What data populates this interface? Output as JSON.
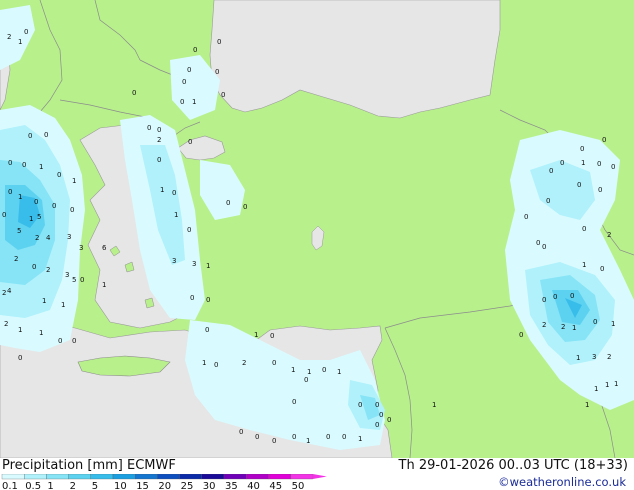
{
  "title": "Precipitation [mm]  ECMWF",
  "date": "Th 29-01-2026 00..03 UTC (18+33)",
  "credit": "©weatheronline.co.uk",
  "colors": {
    "land": "#b8f08c",
    "sea": "#e6e6e6",
    "border": "#8c8c8c",
    "label": "#111111"
  },
  "legend": {
    "ticks": [
      "0.1",
      "0.5",
      "1",
      "2",
      "5",
      "10",
      "15",
      "20",
      "25",
      "30",
      "35",
      "40",
      "45",
      "50"
    ],
    "colors": [
      "#d9fbff",
      "#b0f1fb",
      "#86e4f6",
      "#5dd2f0",
      "#38bdea",
      "#1c9fe0",
      "#1476cf",
      "#0e4fbf",
      "#0a2aa8",
      "#1a0a98",
      "#7000b8",
      "#b000c8",
      "#e000d8",
      "#f233e6"
    ]
  },
  "values": [
    "2",
    "1",
    "0",
    "0",
    "0",
    "0",
    "0",
    "0",
    "0",
    "1",
    "0",
    "0",
    "0",
    "0",
    "0",
    "0",
    "0",
    "0",
    "1",
    "0",
    "1",
    "0",
    "1",
    "0",
    "0",
    "0",
    "0",
    "5",
    "1",
    "4",
    "5",
    "2",
    "3",
    "3",
    "6",
    "2",
    "0",
    "2",
    "3",
    "5",
    "4",
    "1",
    "1",
    "0",
    "1",
    "3",
    "3",
    "1",
    "0",
    "0",
    "2",
    "1",
    "1",
    "0",
    "0",
    "0",
    "0",
    "2",
    "0",
    "0",
    "1",
    "0",
    "1",
    "0",
    "0",
    "2",
    "0",
    "1",
    "0",
    "1",
    "0",
    "2",
    "0",
    "1",
    "1",
    "0",
    "1",
    "0",
    "0",
    "0",
    "0",
    "0",
    "0",
    "0",
    "0",
    "1",
    "0",
    "1",
    "0",
    "0",
    "0",
    "0",
    "1",
    "0",
    "0",
    "0",
    "0",
    "1",
    "0",
    "0",
    "0",
    "0",
    "0",
    "0",
    "0",
    "0",
    "2",
    "0",
    "1",
    "0",
    "0",
    "0",
    "0",
    "2",
    "2",
    "1",
    "0",
    "1",
    "1",
    "3",
    "2",
    "1",
    "1",
    "1",
    "1",
    "0",
    "1",
    "0",
    "0",
    "1"
  ]
}
